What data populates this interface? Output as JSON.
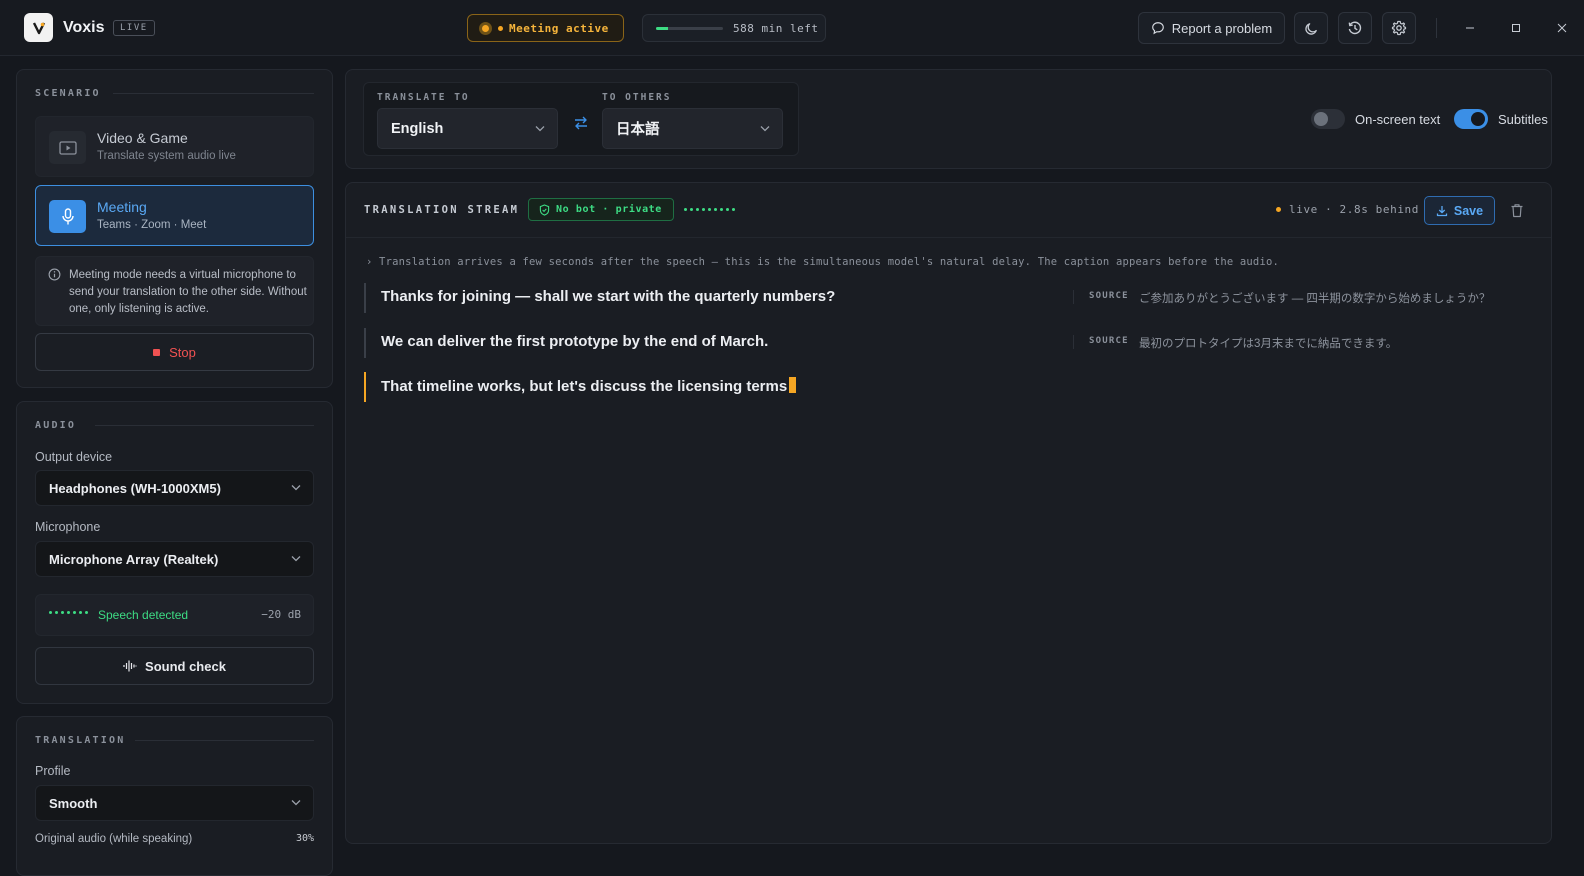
{
  "app": {
    "name": "Voxis",
    "badge": "LIVE",
    "logo_letter": "V"
  },
  "header": {
    "meeting_status": "Meeting active",
    "minutes_left": "588 min left",
    "minutes_progress": 0.18,
    "report_button": "Report a problem",
    "icons": [
      "moon-icon",
      "history-icon",
      "gear-icon"
    ],
    "window_controls": [
      "minimize",
      "maximize",
      "close"
    ]
  },
  "scenario": {
    "title": "SCENARIO",
    "cards": [
      {
        "title": "Video & Game",
        "subtitle": "Translate system audio live",
        "icon": "play-icon",
        "active": false
      },
      {
        "title": "Meeting",
        "subtitle": "Teams · Zoom · Meet",
        "icon": "microphone-icon",
        "active": true
      }
    ],
    "info": "Meeting mode needs a virtual microphone to send your translation to the other side. Without one, only listening is active.",
    "stop_button": "Stop"
  },
  "audio": {
    "title": "AUDIO",
    "output_label": "Output device",
    "output_value": "Headphones (WH-1000XM5)",
    "mic_label": "Microphone",
    "mic_value": "Microphone Array (Realtek)",
    "speech_status": "Speech detected",
    "speech_level": "−20 dB",
    "sound_check": "Sound check"
  },
  "translation": {
    "title": "TRANSLATION",
    "profile_label": "Profile",
    "profile_value": "Smooth",
    "original_audio_label": "Original audio (while speaking)",
    "original_audio_value": "30%"
  },
  "translate": {
    "to_label": "TRANSLATE TO",
    "to_value": "English",
    "others_label": "TO OTHERS",
    "others_value": "日本語",
    "onscreen_label": "On-screen text",
    "onscreen_on": false,
    "subtitles_label": "Subtitles",
    "subtitles_on": true
  },
  "stream": {
    "title": "TRANSLATION STREAM",
    "private_badge": "No bot · private",
    "live_status": "live · 2.8s behind",
    "save_button": "Save",
    "hint": "› Translation arrives a few seconds after the speech — this is the simultaneous model's natural delay. The caption appears before the audio.",
    "source_label": "SOURCE",
    "captions": [
      {
        "text": "Thanks for joining — shall we start with the quarterly numbers?",
        "source": "ご参加ありがとうございます — 四半期の数字から始めましょうか？"
      },
      {
        "text": "We can deliver the first prototype by the end of March.",
        "source": "最初のプロトタイプは3月末までに納品できます。"
      },
      {
        "text": "That timeline works, but let's discuss the licensing terms",
        "source": ""
      }
    ]
  },
  "colors": {
    "accent": "#3b8fe6",
    "warning": "#f5a623",
    "success": "#3ddc84",
    "danger": "#f05252",
    "background": "#15181e"
  }
}
